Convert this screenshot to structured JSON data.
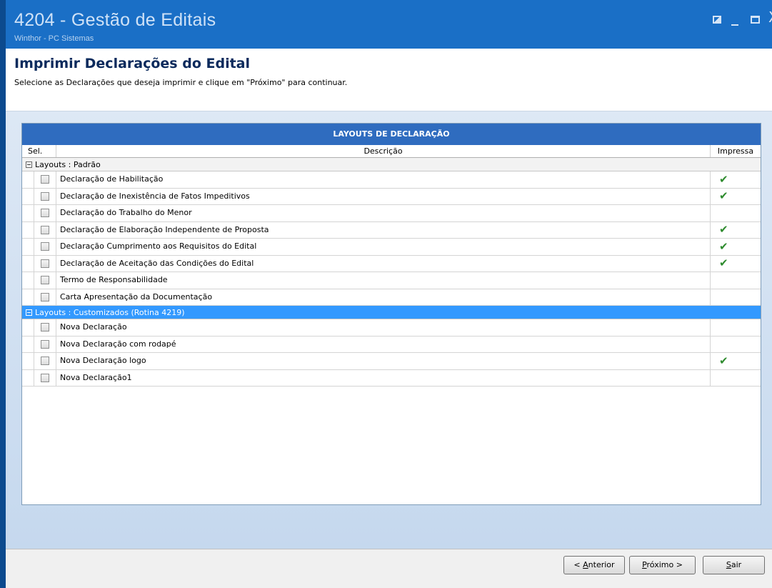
{
  "window": {
    "title": "4204 - Gestão de Editais",
    "subtitle": "Winthor - PC Sistemas",
    "controls": {
      "close_glyph": "X"
    }
  },
  "header": {
    "title": "Imprimir Declarações do Edital",
    "instruction": "Selecione as Declarações que deseja imprimir e clique em \"Próximo\" para continuar."
  },
  "grid": {
    "caption": "LAYOUTS DE DECLARAÇÃO",
    "columns": {
      "sel": "Sel.",
      "desc": "Descrição",
      "printed": "Impressa"
    },
    "groups": [
      {
        "label": "Layouts : Padrão",
        "selected": false,
        "rows": [
          {
            "desc": "Declaração de Habilitação",
            "checked": false,
            "printed": true
          },
          {
            "desc": "Declaração de Inexistência de Fatos Impeditivos",
            "checked": false,
            "printed": true
          },
          {
            "desc": "Declaração do Trabalho do Menor",
            "checked": false,
            "printed": false
          },
          {
            "desc": "Declaração de Elaboração Independente de Proposta",
            "checked": false,
            "printed": true
          },
          {
            "desc": "Declaração Cumprimento aos Requisitos do Edital",
            "checked": false,
            "printed": true
          },
          {
            "desc": "Declaração de Aceitação das Condições do Edital",
            "checked": false,
            "printed": true
          },
          {
            "desc": "Termo de Responsabilidade",
            "checked": false,
            "printed": false
          },
          {
            "desc": "Carta Apresentação da Documentação",
            "checked": false,
            "printed": false
          }
        ]
      },
      {
        "label": "Layouts : Customizados (Rotina 4219)",
        "selected": true,
        "rows": [
          {
            "desc": "Nova Declaração",
            "checked": false,
            "printed": false
          },
          {
            "desc": "Nova Declaração com rodapé",
            "checked": false,
            "printed": false
          },
          {
            "desc": "Nova Declaração logo",
            "checked": false,
            "printed": true
          },
          {
            "desc": "Nova Declaração1",
            "checked": false,
            "printed": false
          }
        ]
      }
    ],
    "check_glyph": "✔"
  },
  "footer": {
    "prev": {
      "pre": "< ",
      "key": "A",
      "post": "nterior"
    },
    "next": {
      "pre": "",
      "key": "P",
      "post": "róximo >"
    },
    "quit": {
      "pre": "",
      "key": "S",
      "post": "air"
    }
  },
  "colors": {
    "titlebar": "#1a6fc6",
    "caption": "#2f6cbf",
    "selected_group": "#3399ff",
    "check": "#2e8b2e"
  },
  "icons": {
    "restore": "restore-icon",
    "minimize": "minimize-icon",
    "maximize": "maximize-icon",
    "close": "close-icon",
    "expander": "collapse-icon",
    "printed": "checkmark-icon"
  }
}
